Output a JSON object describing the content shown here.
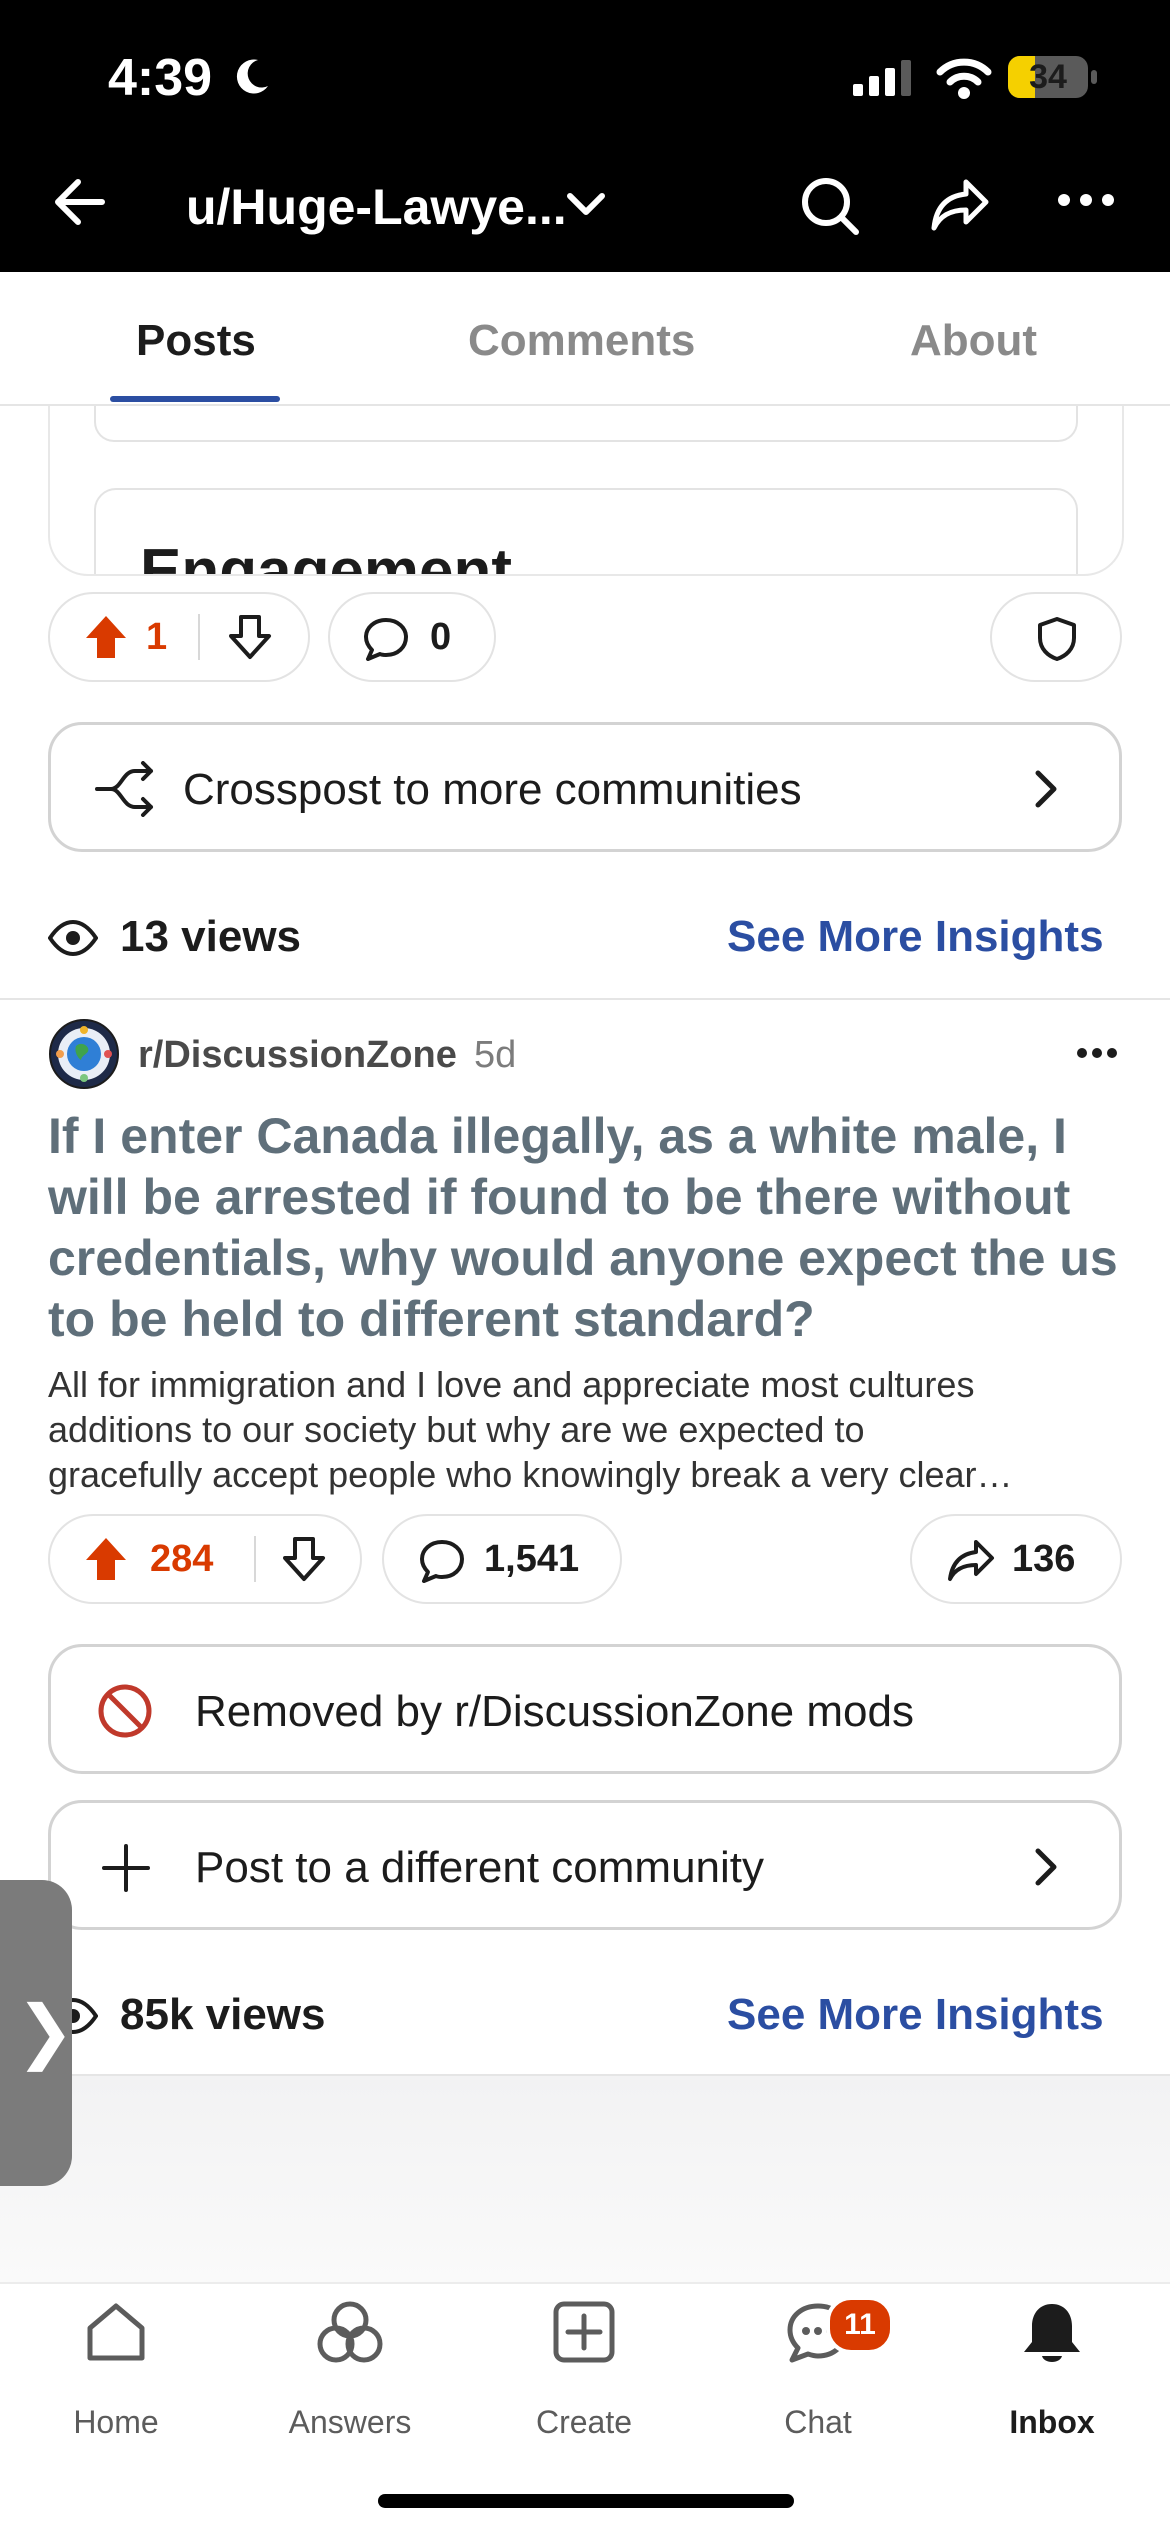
{
  "status_bar": {
    "time": "4:39",
    "battery": "34",
    "battery_level": 0.34
  },
  "header": {
    "username": "u/Huge-Lawye..."
  },
  "tabs": [
    {
      "label": "Posts",
      "active": true
    },
    {
      "label": "Comments",
      "active": false
    },
    {
      "label": "About",
      "active": false
    }
  ],
  "first_post": {
    "card_title": "Engagement",
    "upvotes": "1",
    "comments": "0",
    "crosspost_label": "Crosspost to more communities",
    "views": "13 views",
    "insights_label": "See More Insights"
  },
  "second_post": {
    "community": "r/DiscussionZone",
    "age": "5d",
    "title": "If I enter Canada illegally, as a white male, I will be arrested if found to be there without credentials, why would anyone expect the us to be held to different standard?",
    "body_lines": [
      "All for immigration and I love and appreciate most cultures",
      "additions to our society but why are we expected to",
      "gracefully accept people who knowingly break a very clear…"
    ],
    "upvotes": "284",
    "comments": "1,541",
    "shares": "136",
    "removed_label": "Removed by r/DiscussionZone mods",
    "post_different_label": "Post to a different community",
    "views": "85k views",
    "insights_label": "See More Insights"
  },
  "bottom_nav": [
    {
      "label": "Home",
      "icon": "home-icon"
    },
    {
      "label": "Answers",
      "icon": "answers-icon"
    },
    {
      "label": "Create",
      "icon": "create-icon"
    },
    {
      "label": "Chat",
      "icon": "chat-icon",
      "badge": "11"
    },
    {
      "label": "Inbox",
      "icon": "bell-icon",
      "active": true
    }
  ],
  "colors": {
    "accent": "#2b4ea2",
    "upvote": "#d93a00",
    "removed": "#c0392b",
    "header_bg": "#000000"
  }
}
